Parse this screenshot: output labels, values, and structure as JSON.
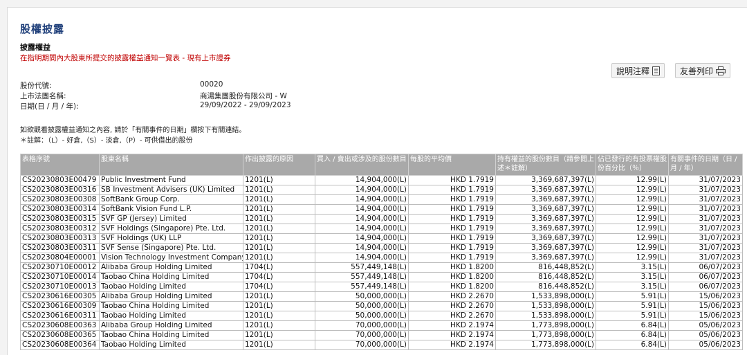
{
  "page": {
    "title": "股權披露",
    "subtitle": "披露權益",
    "description": "在指明期間內大股東所提交的披露權益通知一覽表 - 現有上市證券"
  },
  "buttons": {
    "notes_label": "說明注釋",
    "print_label": "友善列印"
  },
  "info": {
    "stock_code_label": "股份代號:",
    "stock_code": "00020",
    "corp_name_label": "上市法團名稱:",
    "corp_name": "商湯集團股份有限公司 - W",
    "date_label": "日期(日 / 月 / 年):",
    "date_range": "29/09/2022 - 29/09/2023"
  },
  "notes": {
    "line1": "如欲觀看披露權益通知之內容, 請於「有關事件的日期」欄按下有關連結。",
    "line2": "＊註解：（L）- 好倉,（S）- 淡倉,（P）- 可供借出的股份"
  },
  "table": {
    "headers": [
      "表格序號",
      "股東名稱",
      "作出披露的原因",
      "買入 / 賣出或涉及的股份數目",
      "每股的平均價",
      "持有權益的股份數目（請參閱上述＊註解）",
      "佔已發行的有投票權股份百分比（％）",
      "有關事件的日期（日 / 月 / 年）"
    ],
    "rows": [
      [
        "CS20230803E00479",
        "Public Investment Fund",
        "1201(L)",
        "14,904,000(L)",
        "HKD 1.7919",
        "3,369,687,397(L)",
        "12.99(L)",
        "31/07/2023"
      ],
      [
        "CS20230803E00316",
        "SB Investment Advisers (UK) Limited",
        "1201(L)",
        "14,904,000(L)",
        "HKD 1.7919",
        "3,369,687,397(L)",
        "12.99(L)",
        "31/07/2023"
      ],
      [
        "CS20230803E00308",
        "SoftBank Group Corp.",
        "1201(L)",
        "14,904,000(L)",
        "HKD 1.7919",
        "3,369,687,397(L)",
        "12.99(L)",
        "31/07/2023"
      ],
      [
        "CS20230803E00314",
        "SoftBank Vision Fund L.P.",
        "1201(L)",
        "14,904,000(L)",
        "HKD 1.7919",
        "3,369,687,397(L)",
        "12.99(L)",
        "31/07/2023"
      ],
      [
        "CS20230803E00315",
        "SVF GP (Jersey) Limited",
        "1201(L)",
        "14,904,000(L)",
        "HKD 1.7919",
        "3,369,687,397(L)",
        "12.99(L)",
        "31/07/2023"
      ],
      [
        "CS20230803E00312",
        "SVF Holdings (Singapore) Pte. Ltd.",
        "1201(L)",
        "14,904,000(L)",
        "HKD 1.7919",
        "3,369,687,397(L)",
        "12.99(L)",
        "31/07/2023"
      ],
      [
        "CS20230803E00313",
        "SVF Holdings (UK) LLP",
        "1201(L)",
        "14,904,000(L)",
        "HKD 1.7919",
        "3,369,687,397(L)",
        "12.99(L)",
        "31/07/2023"
      ],
      [
        "CS20230803E00311",
        "SVF Sense (Singapore) Pte. Ltd.",
        "1201(L)",
        "14,904,000(L)",
        "HKD 1.7919",
        "3,369,687,397(L)",
        "12.99(L)",
        "31/07/2023"
      ],
      [
        "CS20230804E00001",
        "Vision Technology Investment Company",
        "1201(L)",
        "14,904,000(L)",
        "HKD 1.7919",
        "3,369,687,397(L)",
        "12.99(L)",
        "31/07/2023"
      ],
      [
        "CS20230710E00012",
        "Alibaba Group Holding Limited",
        "1704(L)",
        "557,449,148(L)",
        "HKD 1.8200",
        "816,448,852(L)",
        "3.15(L)",
        "06/07/2023"
      ],
      [
        "CS20230710E00014",
        "Taobao China Holding Limited",
        "1704(L)",
        "557,449,148(L)",
        "HKD 1.8200",
        "816,448,852(L)",
        "3.15(L)",
        "06/07/2023"
      ],
      [
        "CS20230710E00013",
        "Taobao Holding Limited",
        "1704(L)",
        "557,449,148(L)",
        "HKD 1.8200",
        "816,448,852(L)",
        "3.15(L)",
        "06/07/2023"
      ],
      [
        "CS20230616E00305",
        "Alibaba Group Holding Limited",
        "1201(L)",
        "50,000,000(L)",
        "HKD 2.2670",
        "1,533,898,000(L)",
        "5.91(L)",
        "15/06/2023"
      ],
      [
        "CS20230616E00309",
        "Taobao China Holding Limited",
        "1201(L)",
        "50,000,000(L)",
        "HKD 2.2670",
        "1,533,898,000(L)",
        "5.91(L)",
        "15/06/2023"
      ],
      [
        "CS20230616E00311",
        "Taobao Holding Limited",
        "1201(L)",
        "50,000,000(L)",
        "HKD 2.2670",
        "1,533,898,000(L)",
        "5.91(L)",
        "15/06/2023"
      ],
      [
        "CS20230608E00363",
        "Alibaba Group Holding Limited",
        "1201(L)",
        "70,000,000(L)",
        "HKD 2.1974",
        "1,773,898,000(L)",
        "6.84(L)",
        "05/06/2023"
      ],
      [
        "CS20230608E00365",
        "Taobao China Holding Limited",
        "1201(L)",
        "70,000,000(L)",
        "HKD 2.1974",
        "1,773,898,000(L)",
        "6.84(L)",
        "05/06/2023"
      ],
      [
        "CS20230608E00364",
        "Taobao Holding Limited",
        "1201(L)",
        "70,000,000(L)",
        "HKD 2.1974",
        "1,773,898,000(L)",
        "6.84(L)",
        "05/06/2023"
      ]
    ]
  }
}
